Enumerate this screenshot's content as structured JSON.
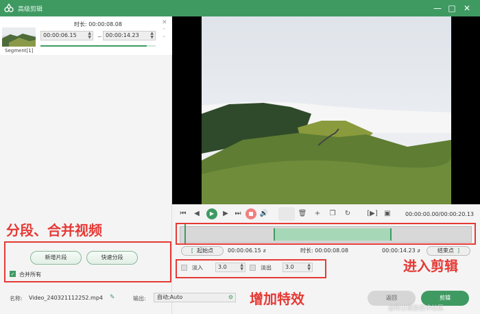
{
  "window": {
    "title": "高级剪辑"
  },
  "segment": {
    "label": "Segment[1]",
    "duration_label": "时长:",
    "duration_value": "00:00:08.08",
    "start_time": "00:00:06.15",
    "end_time": "00:00:14.23",
    "separator": "~",
    "progress": 0.92
  },
  "left_actions": {
    "new_segment": "新增片段",
    "quick_split": "快速分段",
    "merge_all": "合并所有",
    "merge_all_checked": true
  },
  "annotations": {
    "split_merge": "分段、合并视频",
    "enter_trim": "进入剪辑",
    "add_effects": "增加特效"
  },
  "player": {
    "time_readout": "00:00:00.00/00:00:20.13"
  },
  "trim": {
    "start_button": "起始点",
    "start_bracket": "[",
    "start_value": "00:00:06.15",
    "duration_label": "时长:",
    "duration_value": "00:00:08.08",
    "end_value": "00:00:14.23",
    "end_button": "结束点",
    "end_bracket": "]"
  },
  "effects": {
    "fade_in_label": "淡入",
    "fade_in_value": "3.0",
    "fade_out_label": "淡出",
    "fade_out_value": "3.0"
  },
  "bottom": {
    "name_label": "名称:",
    "name_value": "Video_240321112252.mp4",
    "output_label": "输出:",
    "output_value": "自动;Auto",
    "back_button": "返回",
    "trim_button": "剪辑"
  },
  "watermark": "@稀土掘金技术社区",
  "colors": {
    "accent": "#3f9a62",
    "annotation": "#e53935"
  }
}
